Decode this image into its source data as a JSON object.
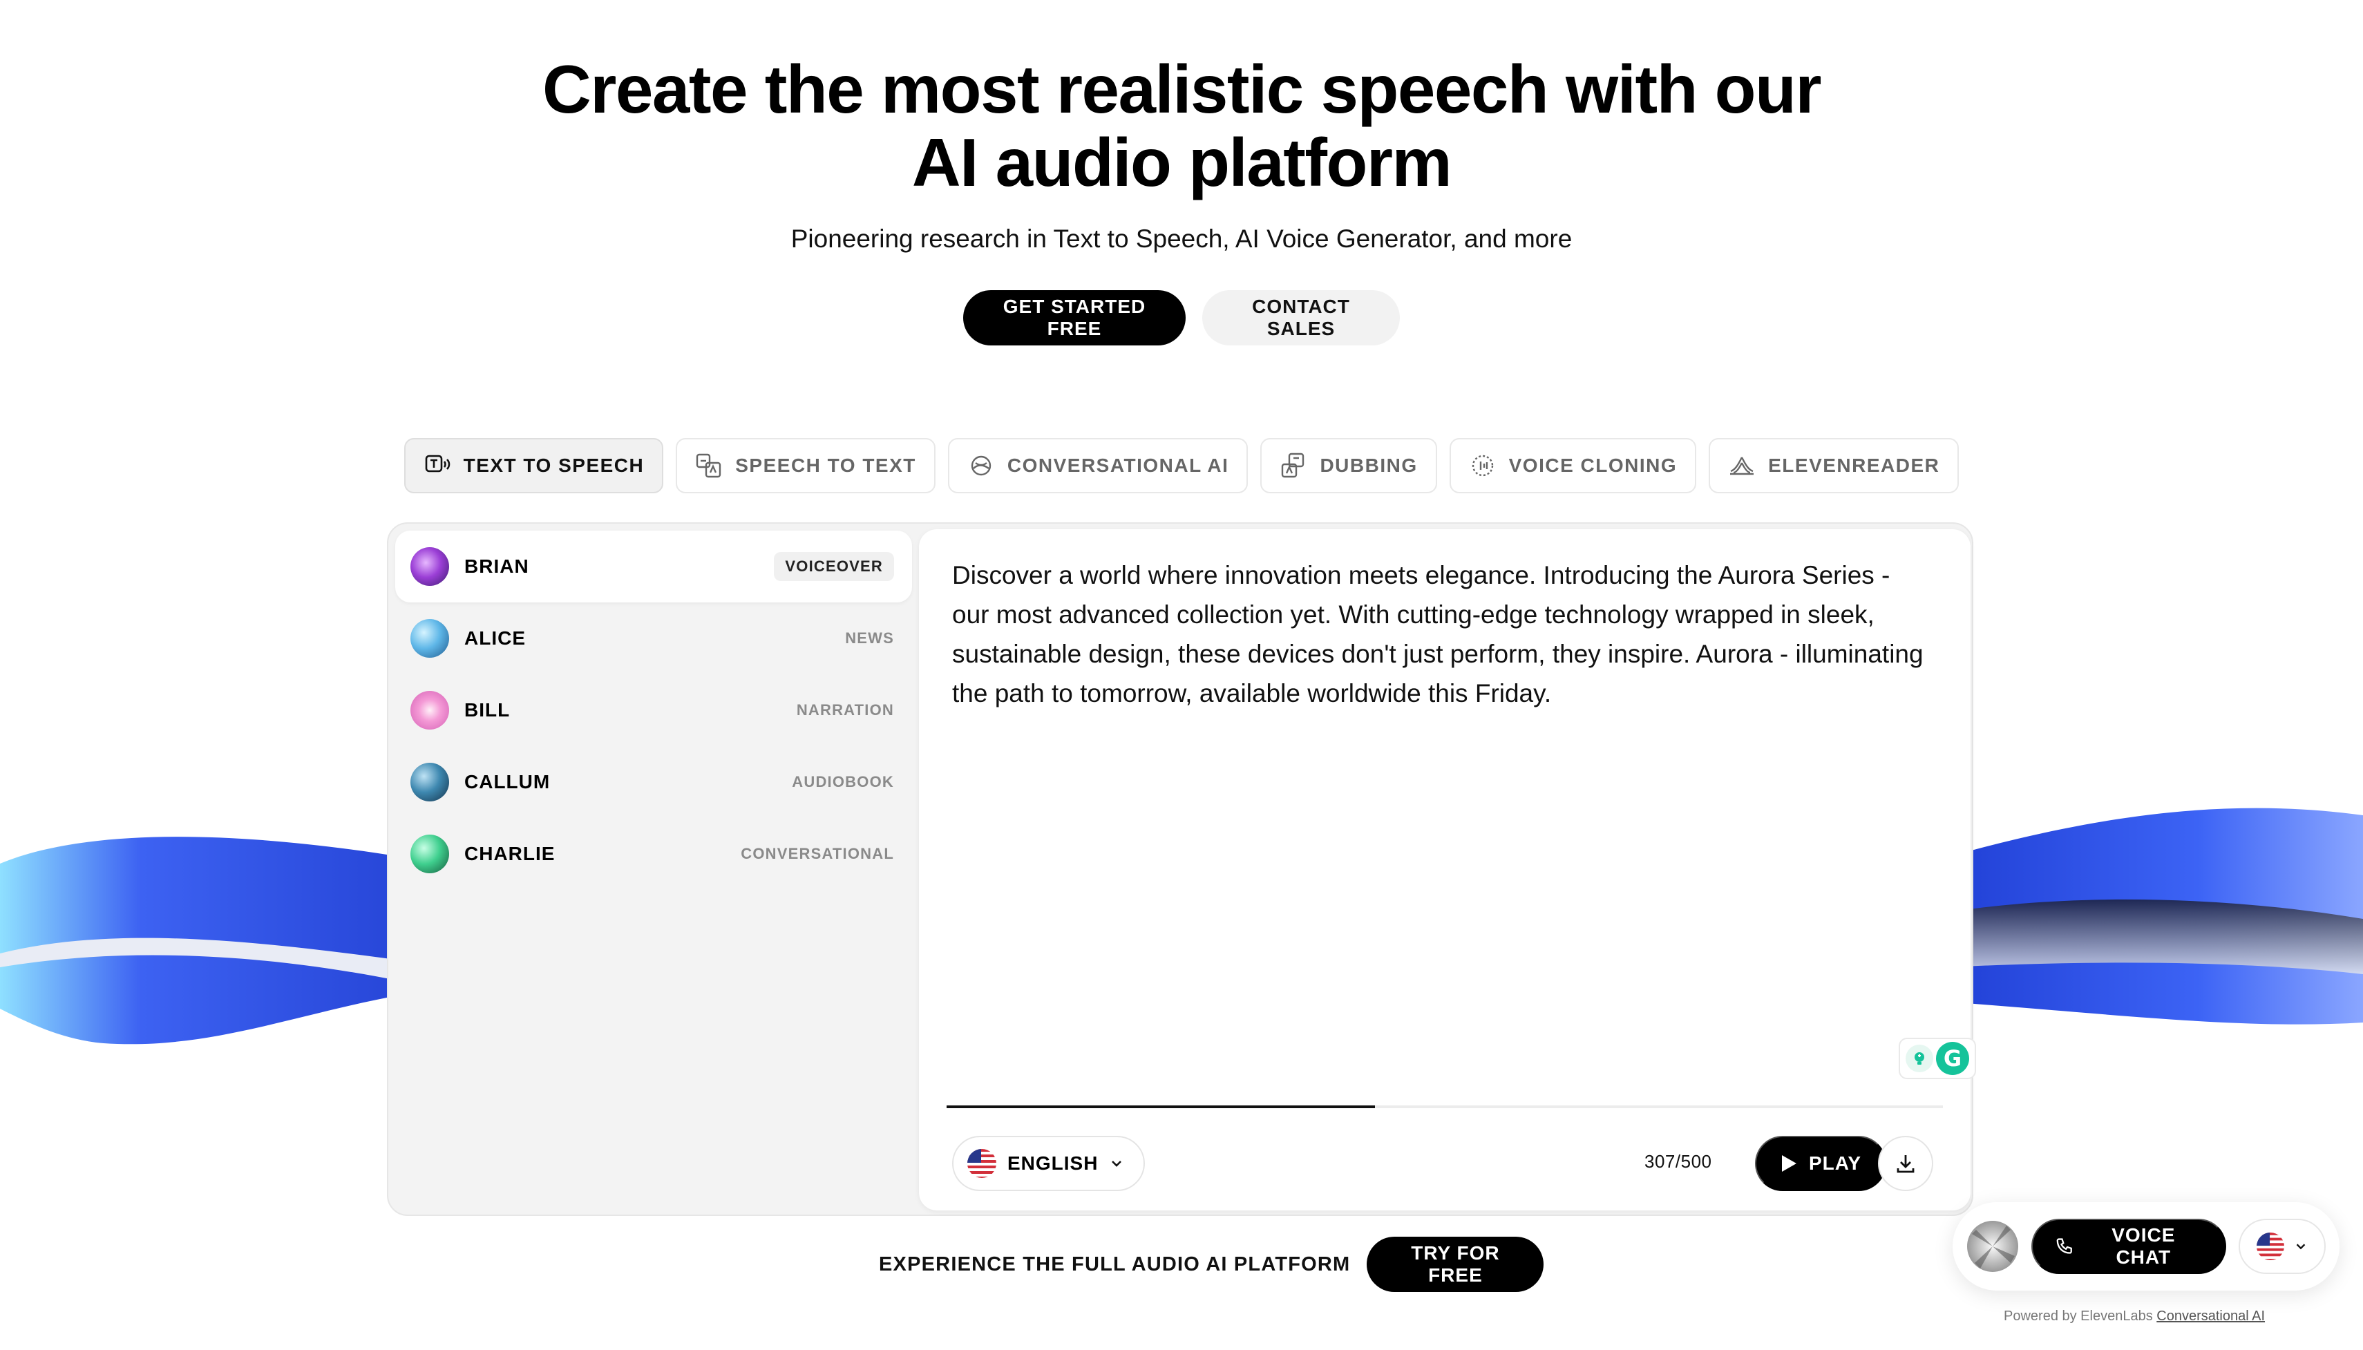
{
  "hero": {
    "title_line1": "Create the most realistic speech with our",
    "title_line2": "AI audio platform",
    "subtitle": "Pioneering research in Text to Speech, AI Voice Generator, and more",
    "primary_cta": "GET STARTED FREE",
    "secondary_cta": "CONTACT SALES"
  },
  "tabs": [
    {
      "label": "TEXT TO SPEECH",
      "icon": "text-to-speech-icon",
      "active": true
    },
    {
      "label": "SPEECH TO TEXT",
      "icon": "speech-to-text-icon",
      "active": false
    },
    {
      "label": "CONVERSATIONAL AI",
      "icon": "conversational-ai-icon",
      "active": false
    },
    {
      "label": "DUBBING",
      "icon": "dubbing-icon",
      "active": false
    },
    {
      "label": "VOICE CLONING",
      "icon": "voice-cloning-icon",
      "active": false
    },
    {
      "label": "ELEVENREADER",
      "icon": "elevenreader-icon",
      "active": false
    }
  ],
  "voices": [
    {
      "name": "BRIAN",
      "tag": "VOICEOVER",
      "active": true
    },
    {
      "name": "ALICE",
      "tag": "NEWS",
      "active": false
    },
    {
      "name": "BILL",
      "tag": "NARRATION",
      "active": false
    },
    {
      "name": "CALLUM",
      "tag": "AUDIOBOOK",
      "active": false
    },
    {
      "name": "CHARLIE",
      "tag": "CONVERSATIONAL",
      "active": false
    }
  ],
  "editor": {
    "text": "Discover a world where innovation meets elegance. Introducing the Aurora Series - our most advanced collection yet. With cutting-edge technology wrapped in sleek, sustainable design, these devices don't just perform, they inspire. Aurora - illuminating the path to tomorrow, available worldwide this Friday.",
    "language": "ENGLISH",
    "char_count": "307/500",
    "progress_fraction": 0.43,
    "play_label": "PLAY"
  },
  "bottom_cta": {
    "label": "EXPERIENCE THE FULL AUDIO AI PLATFORM",
    "button": "TRY FOR FREE"
  },
  "widget": {
    "voice_chat_label": "VOICE CHAT",
    "powered_prefix": "Powered by ElevenLabs",
    "powered_link": "Conversational AI"
  },
  "colors": {
    "accent_wave": "#3a5ef0",
    "primary_button": "#000000",
    "grammarly": "#15c39a"
  }
}
